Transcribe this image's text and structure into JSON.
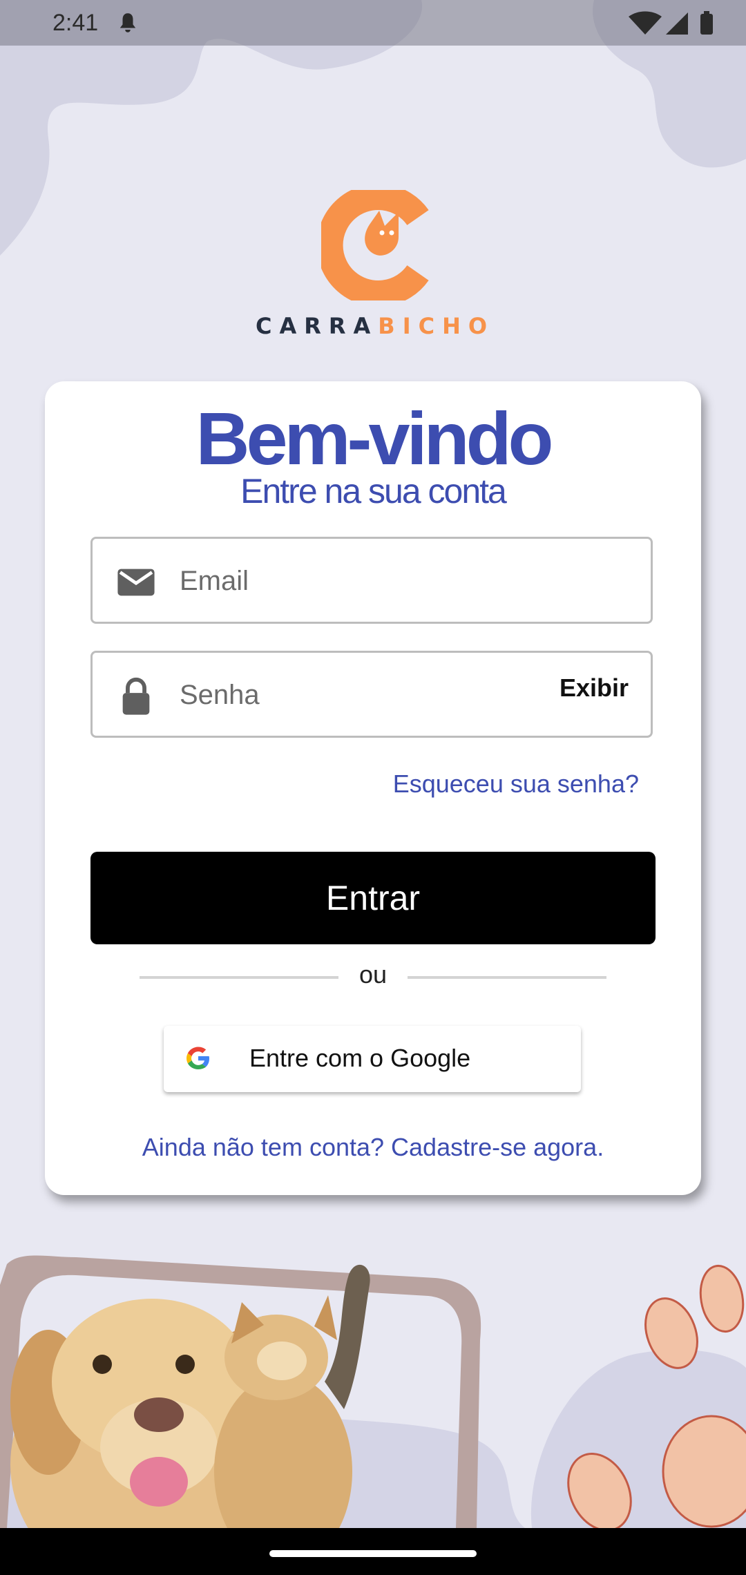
{
  "status_bar": {
    "time": "2:41"
  },
  "brand": {
    "name_part1": "CARRA",
    "name_part2": "BICHO"
  },
  "login": {
    "title": "Bem-vindo",
    "subtitle": "Entre na sua conta",
    "email_placeholder": "Email",
    "password_placeholder": "Senha",
    "show_password_label": "Exibir",
    "forgot_password": "Esqueceu sua senha?",
    "submit_label": "Entrar",
    "divider": "ou",
    "google_label": "Entre com o Google",
    "signup": "Ainda não tem conta? Cadastre-se agora."
  },
  "colors": {
    "accent": "#3d4db0",
    "brand_orange": "#f7924a",
    "brand_dark": "#263042",
    "background": "#e8e8f2"
  },
  "icons": [
    "bell-icon",
    "wifi-icon",
    "signal-icon",
    "battery-icon",
    "mail-icon",
    "lock-icon",
    "google-icon",
    "paw-icon"
  ]
}
